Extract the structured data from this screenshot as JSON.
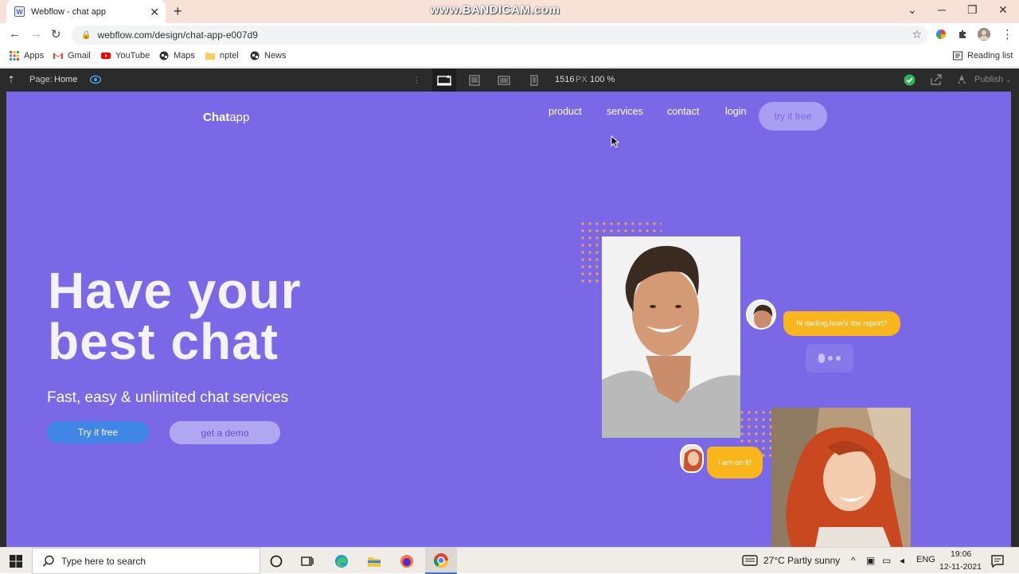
{
  "browser": {
    "tab_title": "Webflow - chat app",
    "tab_favicon_letter": "W",
    "new_tab_label": "+",
    "watermark": "www.BANDICAM.com",
    "url": "webflow.com/design/chat-app-e007d9",
    "window_controls": {
      "minimize": "─",
      "restore": "❐",
      "close": "✕",
      "dropdown": "⌄"
    }
  },
  "bookmarks": [
    {
      "label": "Apps",
      "icon": "apps-grid-icon"
    },
    {
      "label": "Gmail",
      "icon": "gmail-icon"
    },
    {
      "label": "YouTube",
      "icon": "youtube-icon"
    },
    {
      "label": "Maps",
      "icon": "globe-icon"
    },
    {
      "label": "nptel",
      "icon": "folder-icon"
    },
    {
      "label": "News",
      "icon": "globe-icon"
    }
  ],
  "reading_list": "Reading list",
  "webflow_toolbar": {
    "page_label": "Page:",
    "page_name": "Home",
    "width_value": "1516",
    "width_unit": "PX",
    "zoom": "100 %",
    "publish_label": "Publish"
  },
  "site": {
    "logo_bold": "Chat",
    "logo_rest": "app",
    "nav": [
      "product",
      "services",
      "contact",
      "login"
    ],
    "nav_cta": "try it free",
    "hero_title_line1": "Have your",
    "hero_title_line2": "best chat",
    "hero_subtitle": "Fast, easy & unlimited chat  services",
    "primary_button": "Try it free",
    "secondary_button": "get a demo",
    "chat_bubble_1": "hi darling,how's the report?",
    "chat_bubble_2": "i am on it!",
    "colors": {
      "background": "#7b68e7",
      "accent_yellow": "#f9b51c",
      "button_blue": "#3f86e6"
    }
  },
  "taskbar": {
    "search_placeholder": "Type here to search",
    "weather": "27°C  Partly sunny",
    "language": "ENG",
    "time": "19:06",
    "date": "12-11-2021"
  }
}
